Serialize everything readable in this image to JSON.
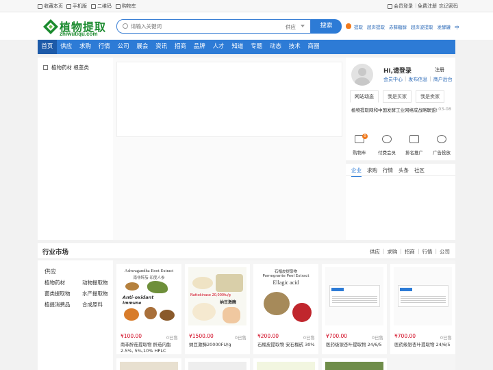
{
  "topbar": {
    "left": [
      "收藏本页",
      "手机版",
      "二维码",
      "购物车"
    ],
    "right": [
      "会员登录",
      "免费注册",
      "忘记密码"
    ]
  },
  "logo": {
    "cn": "植物提取",
    "en": "zhiwutiqu.com"
  },
  "search": {
    "placeholder": "请输入关键词",
    "scope": "供应",
    "button": "搜索"
  },
  "hot_words": [
    "提取",
    "超声提取",
    "赤藓糖醇",
    "超声波提取",
    "发酵罐",
    "中"
  ],
  "nav": [
    "首页",
    "供应",
    "求购",
    "行情",
    "公司",
    "展会",
    "资讯",
    "招商",
    "品牌",
    "人才",
    "知道",
    "专题",
    "动态",
    "技术",
    "商圈"
  ],
  "left_category": "植物药材 根茎类",
  "user": {
    "greeting": "Hi,请登录",
    "register": "注册",
    "links": [
      "会员中心",
      "发布信息",
      "商户后台"
    ],
    "tabs": [
      "网站动态",
      "我是买家",
      "我是卖家"
    ],
    "news": {
      "title": "植物提取网和中国发酵工业网络成战略联盟!",
      "date": "03-08"
    }
  },
  "quick": [
    {
      "label": "购物车",
      "icon": "cart-icon",
      "badge": "0"
    },
    {
      "label": "付费会员",
      "icon": "vip-icon"
    },
    {
      "label": "排名推广",
      "icon": "rank-icon"
    },
    {
      "label": "广告投放",
      "icon": "ad-icon"
    }
  ],
  "info_tabs": [
    "企业",
    "求购",
    "行情",
    "头条",
    "社区"
  ],
  "market": {
    "title": "行业市场",
    "links": [
      "供应",
      "求购",
      "招商",
      "行情",
      "公司"
    ],
    "group": "供应",
    "categories": [
      "植物药材",
      "动物提取物",
      "菌类提取物",
      "水产提取物",
      "植提消费品",
      "合成原料"
    ]
  },
  "products": [
    {
      "price": "¥100.00",
      "sold": "0已售",
      "name": "南非醉茄提取物 醉茄内酯2.5%, 5%,10% HPLC",
      "img_title": "Ashwagandha Root Extract",
      "img_sub": "南非醉茄-印度人参",
      "img_tag": "Anti-oxidant",
      "img_tag2": "Immune"
    },
    {
      "price": "¥1500.00",
      "sold": "0已售",
      "name": "纳豆激酶20000FU/g",
      "img_title": "Nattokinase 20,000fu/g",
      "img_sub": "纳豆激酶"
    },
    {
      "price": "¥200.00",
      "sold": "0已售",
      "name": "石榴皮提取物 安石榴甙 30%",
      "img_title": "石榴皮提取物",
      "img_sub": "Pomegrante Peel Extract",
      "img_tag": "Ellagic acid"
    },
    {
      "price": "¥700.00",
      "sold": "0已售",
      "name": "医药级银杏叶提取物 24/6/5"
    },
    {
      "price": "¥700.00",
      "sold": "0已售",
      "name": "医药级银杏叶提取物 24/6/5"
    }
  ],
  "colors": {
    "primary": "#2d7bd6",
    "nav_active": "#1d5aa8",
    "price": "#d0021b",
    "logo": "#1a8a2e",
    "hot": "#f07a1e"
  }
}
